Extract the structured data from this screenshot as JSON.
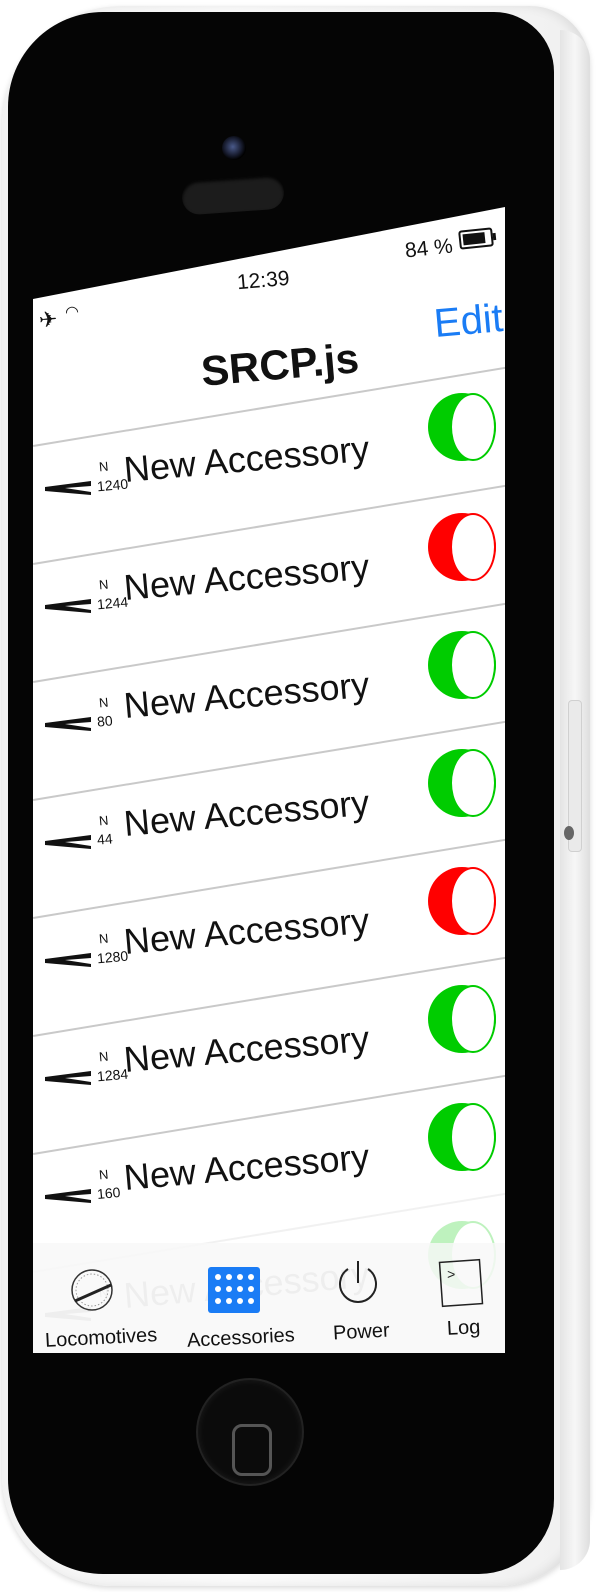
{
  "status_bar": {
    "time": "12:39",
    "battery_text": "84 %",
    "airplane_icon": "airplane-icon",
    "wifi_icon": "wifi-icon",
    "battery_icon": "battery-icon"
  },
  "nav": {
    "title": "SRCP.js",
    "edit_label": "Edit"
  },
  "colors": {
    "on": "#00cc00",
    "off": "#ff0000",
    "accent": "#1a7cf5",
    "tab_active": "#1a7cf5"
  },
  "accessories": [
    {
      "addr_prefix": "N",
      "address": "1240",
      "label": "New Accessory",
      "state": "on"
    },
    {
      "addr_prefix": "N",
      "address": "1244",
      "label": "New Accessory",
      "state": "off"
    },
    {
      "addr_prefix": "N",
      "address": "80",
      "label": "New Accessory",
      "state": "on"
    },
    {
      "addr_prefix": "N",
      "address": "44",
      "label": "New Accessory",
      "state": "on"
    },
    {
      "addr_prefix": "N",
      "address": "1280",
      "label": "New Accessory",
      "state": "off"
    },
    {
      "addr_prefix": "N",
      "address": "1284",
      "label": "New Accessory",
      "state": "on"
    },
    {
      "addr_prefix": "N",
      "address": "160",
      "label": "New Accessory",
      "state": "on"
    },
    {
      "addr_prefix": "N",
      "address": "",
      "label": "New Accessory",
      "state": "on"
    }
  ],
  "tab_bar": {
    "tabs": [
      {
        "label": "Locomotives",
        "icon": "speedometer-icon",
        "active": false
      },
      {
        "label": "Accessories",
        "icon": "switchboard-icon",
        "active": true
      },
      {
        "label": "Power",
        "icon": "power-icon",
        "active": false
      },
      {
        "label": "Log",
        "icon": "terminal-icon",
        "active": false
      }
    ]
  }
}
